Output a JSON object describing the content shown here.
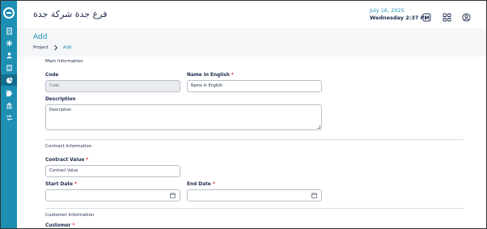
{
  "header": {
    "org_name": "فرع جدة شركة جدة",
    "date": "July 16, 2025",
    "day_time": "Wednesday  2:37 PM",
    "icons": [
      "checklist-icon",
      "apps-grid-icon",
      "user-account-icon"
    ]
  },
  "sidebar": {
    "logo": "app-logo",
    "icons": [
      "document-icon",
      "snowflake-icon",
      "person-icon",
      "building-icon",
      "pie-chart-icon",
      "tag-icon",
      "bank-icon",
      "swap-icon"
    ],
    "active_index": 4
  },
  "page": {
    "title": "Add",
    "breadcrumb": [
      "Project",
      "Add"
    ]
  },
  "form": {
    "main_section": "Main Information",
    "code_label": "Code",
    "code_placeholder": "Code",
    "name_en_label": "Name In English",
    "name_en_placeholder": "Name In English",
    "description_label": "Description",
    "description_placeholder": "Description",
    "contract_section": "Contract Information",
    "contract_value_label": "Contract Value",
    "contract_value_placeholder": "Contract Value",
    "start_date_label": "Start Date",
    "end_date_label": "End Date",
    "customer_section": "Customer Information",
    "customer_label": "Customer",
    "required_mark": "*"
  },
  "colors": {
    "accent": "#1d8fb3",
    "sidebar": "#1d8fb3",
    "required": "#e0303a",
    "text": "#1d2b4f"
  }
}
